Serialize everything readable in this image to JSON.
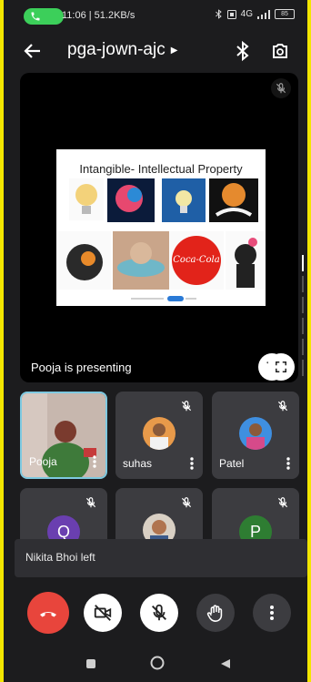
{
  "status_bar": {
    "time_speed": "11:06 | 51.2KB/s",
    "signal_label": "4G",
    "battery_label": "85"
  },
  "app_bar": {
    "meeting_code": "pga-jown-ajc"
  },
  "presentation": {
    "slide_title": "Intangible- Intellectual Property",
    "presenting_text": "Pooja is presenting",
    "slide_logo_text": "Coca-Cola"
  },
  "participants": [
    {
      "name": "Pooja",
      "letter": ""
    },
    {
      "name": "suhas",
      "letter": ""
    },
    {
      "name": "Patel",
      "letter": ""
    },
    {
      "name": "",
      "letter": "Q"
    },
    {
      "name": "",
      "letter": ""
    },
    {
      "name": "",
      "letter": "P"
    }
  ],
  "toast": {
    "message": "Nikita Bhoi left"
  },
  "colors": {
    "end_call": "#e8453c",
    "tile": "#3c3c40",
    "active_border": "#7ec9e0"
  }
}
